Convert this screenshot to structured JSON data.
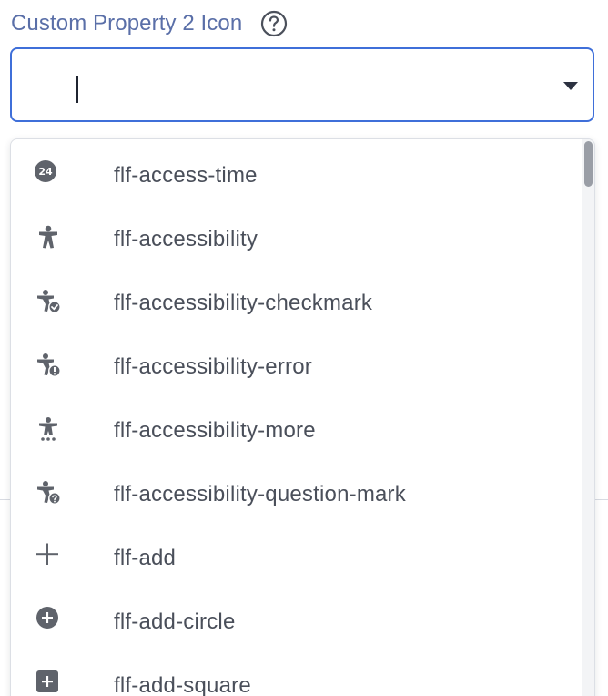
{
  "field": {
    "label": "Custom Property 2 Icon",
    "help_icon": "question-circle-icon",
    "input_value": "",
    "dropdown_icon": "caret-down-icon"
  },
  "menu": {
    "items": [
      {
        "label": "flf-access-time",
        "icon": "access-time-24-icon"
      },
      {
        "label": "flf-accessibility",
        "icon": "accessibility-icon"
      },
      {
        "label": "flf-accessibility-checkmark",
        "icon": "accessibility-checkmark-icon"
      },
      {
        "label": "flf-accessibility-error",
        "icon": "accessibility-error-icon"
      },
      {
        "label": "flf-accessibility-more",
        "icon": "accessibility-more-icon"
      },
      {
        "label": "flf-accessibility-question-mark",
        "icon": "accessibility-question-mark-icon"
      },
      {
        "label": "flf-add",
        "icon": "add-icon"
      },
      {
        "label": "flf-add-circle",
        "icon": "add-circle-icon"
      },
      {
        "label": "flf-add-square",
        "icon": "add-square-icon"
      }
    ]
  },
  "colors": {
    "label": "#5a6fa8",
    "focus_border": "#3f6fd9",
    "item_text": "#4a4f5a",
    "icon": "#5f636b"
  }
}
